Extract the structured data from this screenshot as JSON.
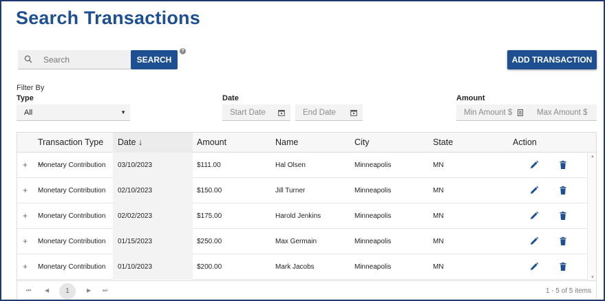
{
  "page": {
    "title": "Search Transactions"
  },
  "search": {
    "placeholder": "Search",
    "button_label": "SEARCH",
    "help_glyph": "?"
  },
  "add_button_label": "ADD TRANSACTION",
  "filters": {
    "filter_by_label": "Filter By",
    "type": {
      "label": "Type",
      "value": "All"
    },
    "date": {
      "label": "Date",
      "start_placeholder": "Start Date",
      "end_placeholder": "End Date"
    },
    "amount": {
      "label": "Amount",
      "min_placeholder": "Min Amount $",
      "max_placeholder": "Max Amount $"
    }
  },
  "table": {
    "columns": [
      "Transaction Type ...",
      "Date ↓",
      "Amount",
      "Name",
      "City",
      "State",
      "Action"
    ],
    "rows": [
      {
        "type": "Monetary Contribution",
        "date": "03/10/2023",
        "amount": "$111.00",
        "name": "Hal Olsen",
        "city": "Minneapolis",
        "state": "MN"
      },
      {
        "type": "Monetary Contribution",
        "date": "02/10/2023",
        "amount": "$150.00",
        "name": "Jill Turner",
        "city": "Minneapolis",
        "state": "MN"
      },
      {
        "type": "Monetary Contribution",
        "date": "02/02/2023",
        "amount": "$175.00",
        "name": "Harold Jenkins",
        "city": "Minneapolis",
        "state": "MN"
      },
      {
        "type": "Monetary Contribution",
        "date": "01/15/2023",
        "amount": "$250.00",
        "name": "Max Germain",
        "city": "Minneapolis",
        "state": "MN"
      },
      {
        "type": "Monetary Contribution",
        "date": "01/10/2023",
        "amount": "$200.00",
        "name": "Mark Jacobs",
        "city": "Minneapolis",
        "state": "MN"
      }
    ],
    "expand_glyph": "+"
  },
  "pager": {
    "current_page": "1",
    "info": "1 - 5 of 5 items"
  },
  "icons": {
    "search": "search-icon",
    "calendar": "calendar-icon",
    "edit": "pencil-icon",
    "delete": "trash-icon",
    "help": "help-icon"
  },
  "colors": {
    "brand": "#1d4f91",
    "frame": "#1e3a6e"
  }
}
